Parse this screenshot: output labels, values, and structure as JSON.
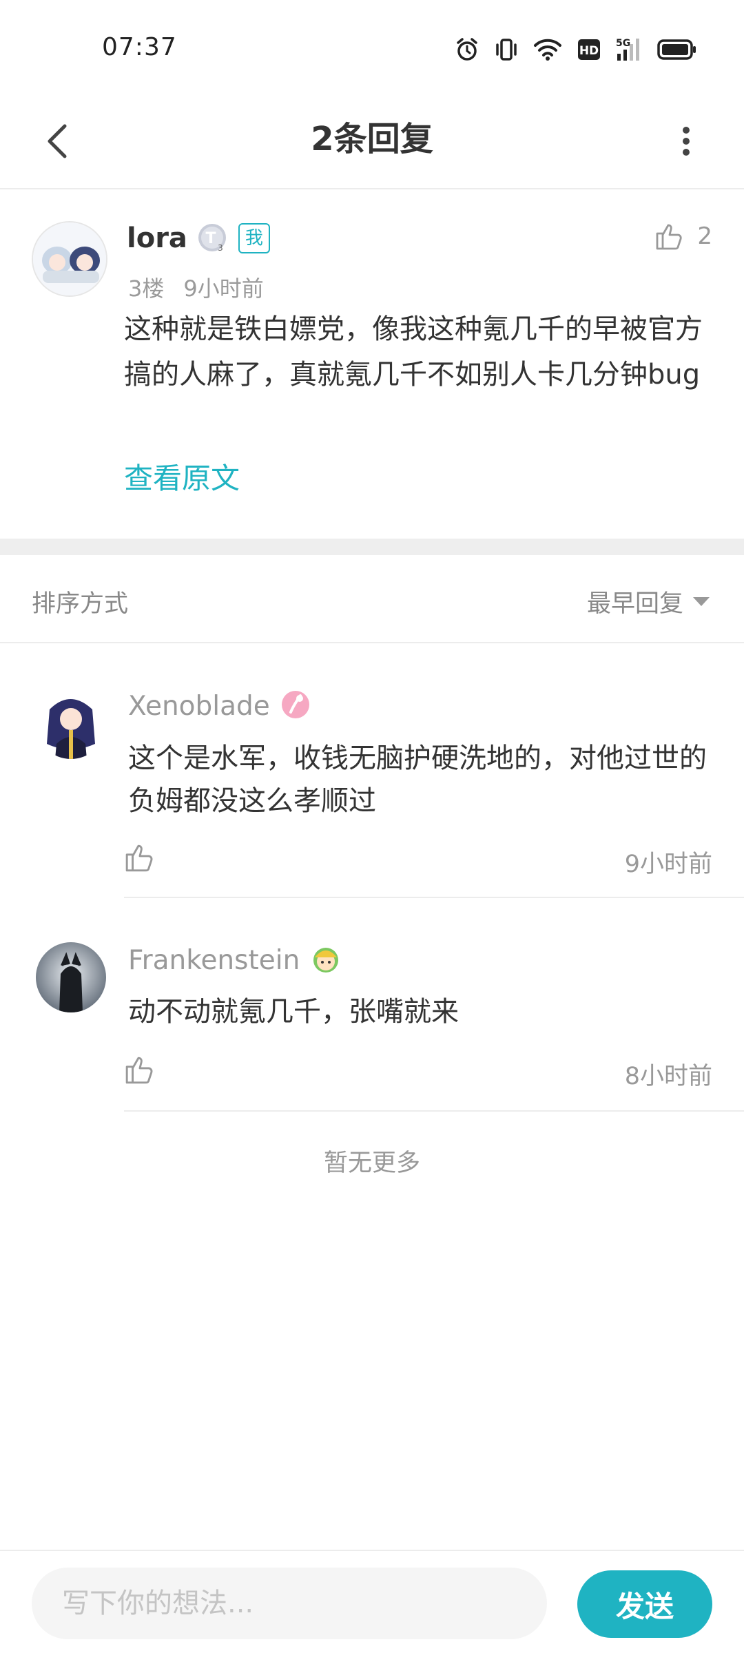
{
  "status_bar": {
    "time": "07:37",
    "icons": [
      "alarm-icon",
      "vibrate-icon",
      "wifi-icon",
      "hd-icon",
      "5g-signal-icon",
      "battery-icon"
    ],
    "hd_text": "HD",
    "network_text": "5G"
  },
  "header": {
    "title": "2条回复",
    "back_icon": "chevron-left-icon",
    "more_icon": "more-vertical-icon"
  },
  "post": {
    "username": "lora",
    "level_badge": "T",
    "level_sub": "3",
    "me_badge": "我",
    "floor": "3楼",
    "time": "9小时前",
    "like_count": "2",
    "content": "这种就是铁白嫖党，像我这种氪几千的早被官方搞的人麻了，真就氪几千不如别人卡几分钟bug",
    "view_original": "查看原文"
  },
  "sort": {
    "label": "排序方式",
    "selected": "最早回复"
  },
  "replies": [
    {
      "username": "Xenoblade",
      "content": "这个是水军，收钱无脑护硬洗地的，对他过世的负姆都没这么孝顺过",
      "time": "9小时前"
    },
    {
      "username": "Frankenstein",
      "content": "动不动就氪几千，张嘴就来",
      "time": "8小时前"
    }
  ],
  "no_more_text": "暂无更多",
  "composer": {
    "placeholder": "写下你的想法...",
    "send_label": "发送"
  },
  "colors": {
    "accent": "#1fb3c2",
    "text_primary": "#333333",
    "text_secondary": "#999999",
    "divider": "#ececec"
  }
}
